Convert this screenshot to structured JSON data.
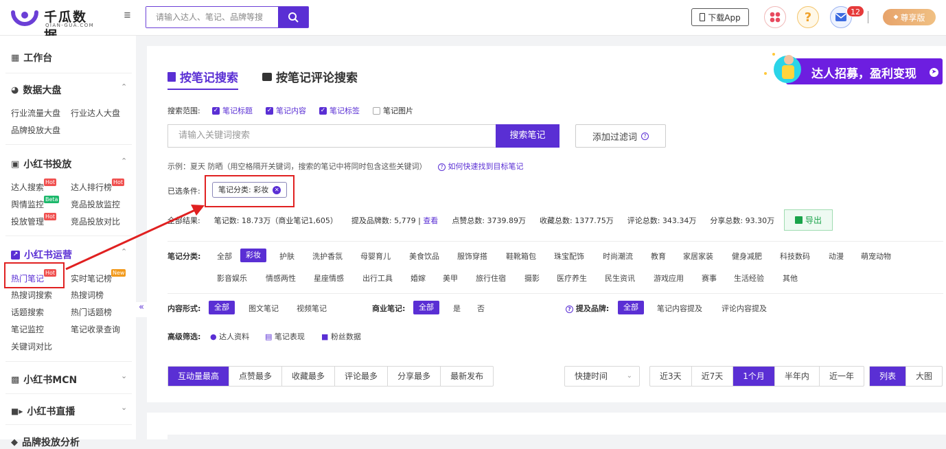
{
  "header": {
    "logo_name": "千瓜数据",
    "logo_sub": "QIAN-GUA.COM",
    "search_placeholder": "请输入达人、笔记、品牌等搜",
    "download_label": "下载App",
    "message_count": "12",
    "vip_label": "尊享版"
  },
  "sidebar": {
    "workspace": "工作台",
    "dashboard": {
      "title": "数据大盘",
      "items": [
        "行业流量大盘",
        "行业达人大盘",
        "品牌投放大盘"
      ]
    },
    "ads": {
      "title": "小红书投放",
      "items": [
        "达人搜索",
        "达人排行榜",
        "舆情监控",
        "竞品投放监控",
        "投放管理",
        "竞品投放对比"
      ],
      "badges": [
        "Hot",
        "Hot",
        "Beta",
        "Hot"
      ]
    },
    "ops": {
      "title": "小红书运营",
      "items": [
        "热门笔记",
        "实时笔记榜",
        "热搜词搜索",
        "热搜词榜",
        "话题搜索",
        "热门话题榜",
        "笔记监控",
        "笔记收录查询",
        "关键词对比"
      ],
      "badges": [
        "Hot",
        "New"
      ]
    },
    "mcn": "小红书MCN",
    "live": "小红书直播",
    "brand": "品牌投放分析"
  },
  "main": {
    "tabs": [
      "按笔记搜索",
      "按笔记评论搜索"
    ],
    "banner_text": "达人招募，盈利变现",
    "scope_label": "搜索范围:",
    "scope_options": [
      {
        "label": "笔记标题",
        "checked": true
      },
      {
        "label": "笔记内容",
        "checked": true
      },
      {
        "label": "笔记标签",
        "checked": true
      },
      {
        "label": "笔记图片",
        "checked": false
      }
    ],
    "keyword_placeholder": "请输入关键词搜索",
    "search_button": "搜索笔记",
    "filter_button": "添加过滤词",
    "example_text": "示例：夏天 防晒（用空格隔开关键词，搜索的笔记中将同时包含这些关键词）",
    "help_link": "如何快速找到目标笔记",
    "conditions_label": "已选条件:",
    "condition_tag": "笔记分类: 彩妆",
    "stats": {
      "prefix": "全部结果:",
      "notes": "笔记数: 18.73万（商业笔记1,605）",
      "brands": "提及品牌数: 5,779 |",
      "view": "查看",
      "likes": "点赞总数: 3739.89万",
      "collects": "收藏总数: 1377.75万",
      "comments": "评论总数: 343.34万",
      "shares": "分享总数: 93.30万"
    },
    "export_label": "导出",
    "category_label": "笔记分类:",
    "categories_row1": [
      "全部",
      "彩妆",
      "护肤",
      "洗护香氛",
      "母婴育儿",
      "美食饮品",
      "服饰穿搭",
      "鞋靴箱包",
      "珠宝配饰",
      "时尚潮流",
      "教育",
      "家居家装",
      "健身减肥",
      "科技数码",
      "动漫",
      "萌宠动物"
    ],
    "categories_row2": [
      "影音娱乐",
      "情感两性",
      "星座情感",
      "出行工具",
      "婚嫁",
      "美甲",
      "旅行住宿",
      "摄影",
      "医疗养生",
      "民生资讯",
      "游戏应用",
      "赛事",
      "生活经验",
      "其他"
    ],
    "form_label": "内容形式:",
    "forms": [
      "全部",
      "图文笔记",
      "视频笔记"
    ],
    "biz_label": "商业笔记:",
    "biz": [
      "全部",
      "是",
      "否"
    ],
    "brand_label": "提及品牌:",
    "brand_opts": [
      "全部",
      "笔记内容提及",
      "评论内容提及"
    ],
    "adv_label": "高级筛选:",
    "adv": [
      "达人资料",
      "笔记表现",
      "粉丝数据"
    ],
    "sort": [
      "互动量最高",
      "点赞最多",
      "收藏最多",
      "评论最多",
      "分享最多",
      "最新发布"
    ],
    "quick_time": "快捷时间",
    "ranges": [
      "近3天",
      "近7天",
      "1个月",
      "半年内",
      "近一年"
    ],
    "views": [
      "列表",
      "大图"
    ]
  }
}
